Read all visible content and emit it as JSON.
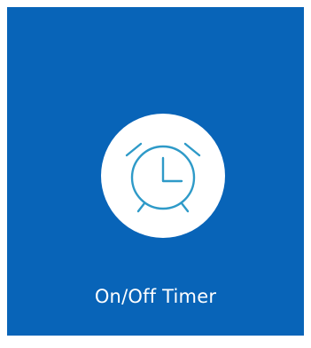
{
  "tile": {
    "label": "On/Off Timer",
    "icon": "alarm-clock-icon",
    "background_color": "#0864b8",
    "icon_color": "#2e9ac8"
  }
}
